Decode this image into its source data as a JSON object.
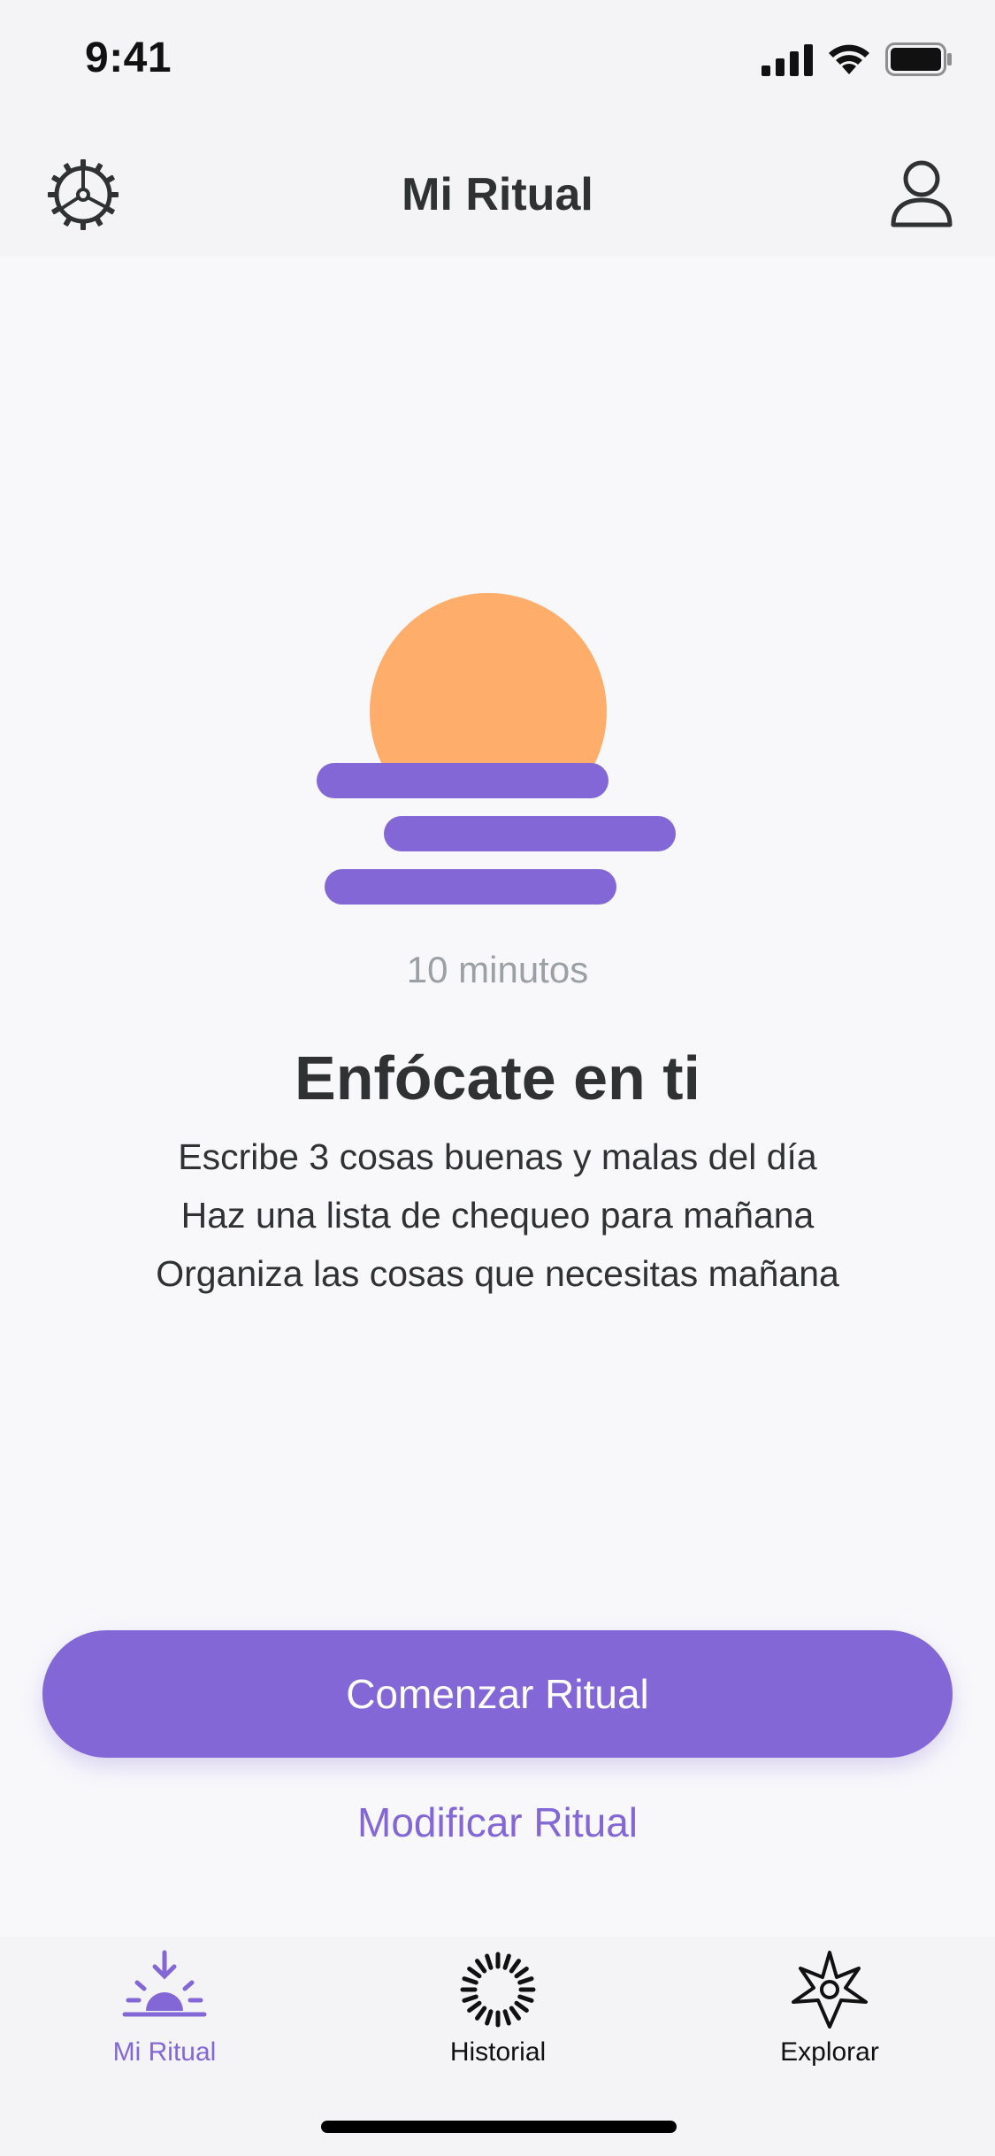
{
  "status_bar": {
    "time": "9:41",
    "icons": [
      "cellular-signal-icon",
      "wifi-icon",
      "battery-icon"
    ]
  },
  "nav": {
    "title": "Mi Ritual",
    "left_icon": "settings-gear-icon",
    "right_icon": "profile-icon"
  },
  "ritual": {
    "illustration": "sunset-icon",
    "duration": "10 minutos",
    "title": "Enfócate en ti",
    "steps": [
      "Escribe 3 cosas buenas y malas del día",
      "Haz una lista de chequeo para mañana",
      "Organiza las cosas que necesitas mañana"
    ]
  },
  "actions": {
    "start_label": "Comenzar Ritual",
    "modify_label": "Modificar Ritual"
  },
  "tab_bar": {
    "tabs": [
      {
        "label": "Mi Ritual",
        "icon": "sunrise-icon",
        "active": true
      },
      {
        "label": "Historial",
        "icon": "history-icon",
        "active": false
      },
      {
        "label": "Explorar",
        "icon": "compass-star-icon",
        "active": false
      }
    ]
  },
  "colors": {
    "accent": "#8467D7",
    "sun": "#FFAD6B",
    "text": "#2F3133",
    "muted": "#9AA0A4",
    "background": "#F8F8FB",
    "bar_background": "#F4F4F6"
  }
}
